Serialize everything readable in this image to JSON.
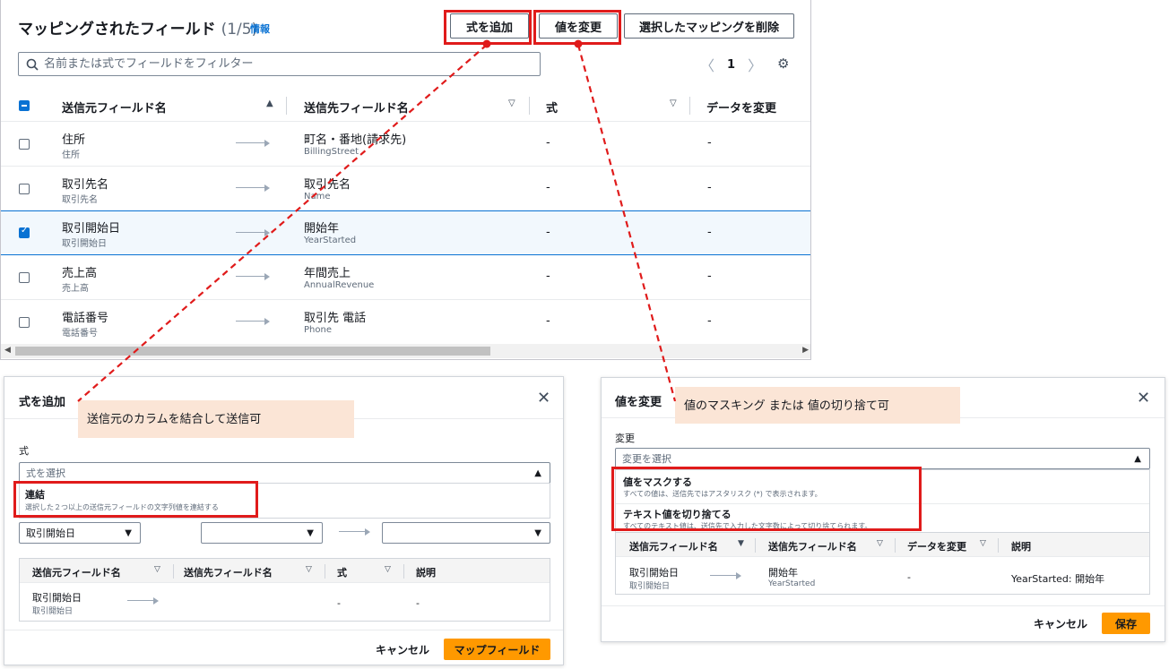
{
  "mapped_fields": {
    "title": "マッピングされたフィールド",
    "count": "(1/5)",
    "info": "情報",
    "buttons": {
      "add_formula": "式を追加",
      "change_value": "値を変更",
      "delete_mapping": "選択したマッピングを削除"
    },
    "search_placeholder": "名前または式でフィールドをフィルター",
    "page": "1",
    "columns": {
      "source": "送信元フィールド名",
      "destination": "送信先フィールド名",
      "formula": "式",
      "modify": "データを変更"
    },
    "rows": [
      {
        "source": "住所",
        "source_sub": "住所",
        "dest": "町名・番地(請求先)",
        "dest_sub": "BillingStreet",
        "formula": "-",
        "modify": "-",
        "checked": false
      },
      {
        "source": "取引先名",
        "source_sub": "取引先名",
        "dest": "取引先名",
        "dest_sub": "Name",
        "formula": "-",
        "modify": "-",
        "checked": false
      },
      {
        "source": "取引開始日",
        "source_sub": "取引開始日",
        "dest": "開始年",
        "dest_sub": "YearStarted",
        "formula": "-",
        "modify": "-",
        "checked": true
      },
      {
        "source": "売上高",
        "source_sub": "売上高",
        "dest": "年間売上",
        "dest_sub": "AnnualRevenue",
        "formula": "-",
        "modify": "-",
        "checked": false
      },
      {
        "source": "電話番号",
        "source_sub": "電話番号",
        "dest": "取引先 電話",
        "dest_sub": "Phone",
        "formula": "-",
        "modify": "-",
        "checked": false
      }
    ]
  },
  "add_formula_dialog": {
    "title": "式を追加",
    "formula_label": "式",
    "formula_placeholder": "式を選択",
    "option": {
      "title": "連結",
      "desc": "選択した２つ以上の送信元フィールドの文字列値を連結する"
    },
    "source_select": "取引開始日",
    "columns": {
      "source": "送信元フィールド名",
      "destination": "送信先フィールド名",
      "formula": "式",
      "desc": "説明"
    },
    "row": {
      "source": "取引開始日",
      "source_sub": "取引開始日",
      "formula": "-",
      "desc": "-"
    },
    "cancel": "キャンセル",
    "submit": "マップフィールド"
  },
  "change_value_dialog": {
    "title": "値を変更",
    "change_label": "変更",
    "change_placeholder": "変更を選択",
    "options": [
      {
        "title": "値をマスクする",
        "desc": "すべての値は、送信先ではアスタリスク (*) で表示されます。"
      },
      {
        "title": "テキスト値を切り捨てる",
        "desc": "すべてのテキスト値は、送信先で入力した文字数によって切り捨てられます。"
      }
    ],
    "columns": {
      "source": "送信元フィールド名",
      "destination": "送信先フィールド名",
      "modify": "データを変更",
      "desc": "説明"
    },
    "row": {
      "source": "取引開始日",
      "source_sub": "取引開始日",
      "dest": "開始年",
      "dest_sub": "YearStarted",
      "modify": "-",
      "desc": "YearStarted: 開始年"
    },
    "cancel": "キャンセル",
    "save": "保存"
  },
  "callouts": {
    "formula_note": "送信元のカラムを結合して送信可",
    "value_note": "値のマスキング または 値の切り捨て可"
  },
  "colors": {
    "annotation_red": "#e01b1b",
    "primary_orange": "#ff9900",
    "link_blue": "#0972d3",
    "callout_bg": "#fbe5d6"
  }
}
